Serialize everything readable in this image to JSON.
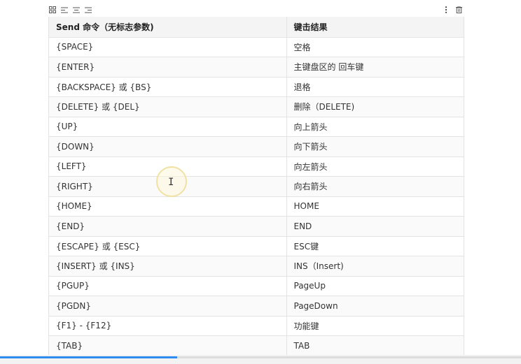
{
  "toolbar": {
    "left_icons": [
      "grid-icon",
      "align-left-icon",
      "align-center-icon",
      "align-right-icon"
    ],
    "right_icons": [
      "more-vertical-icon",
      "trash-icon"
    ]
  },
  "table": {
    "headers": [
      "Send 命令（无标志参数)",
      "键击结果"
    ],
    "rows": [
      [
        "{SPACE}",
        "空格"
      ],
      [
        "{ENTER}",
        "主键盘区的 回车键"
      ],
      [
        "{BACKSPACE} 或 {BS}",
        "退格"
      ],
      [
        "{DELETE} 或 {DEL}",
        "删除（DELETE)"
      ],
      [
        "{UP}",
        "向上箭头"
      ],
      [
        "{DOWN}",
        "向下箭头"
      ],
      [
        "{LEFT}",
        "向左箭头"
      ],
      [
        "{RIGHT}",
        "向右箭头"
      ],
      [
        "{HOME}",
        "HOME"
      ],
      [
        "{END}",
        "END"
      ],
      [
        "{ESCAPE} 或 {ESC}",
        "ESC键"
      ],
      [
        "{INSERT} 或 {INS}",
        "INS（Insert)"
      ],
      [
        "{PGUP}",
        "PageUp"
      ],
      [
        "{PGDN}",
        "PageDown"
      ],
      [
        "{F1} - {F12}",
        "功能键"
      ],
      [
        "{TAB}",
        "TAB"
      ]
    ]
  },
  "video_progress": {
    "fraction": 0.34,
    "color": "#2d8cf0"
  },
  "colors": {
    "header_bg": "#f4f4f4",
    "border": "#e3e3e3",
    "text": "#333333"
  }
}
